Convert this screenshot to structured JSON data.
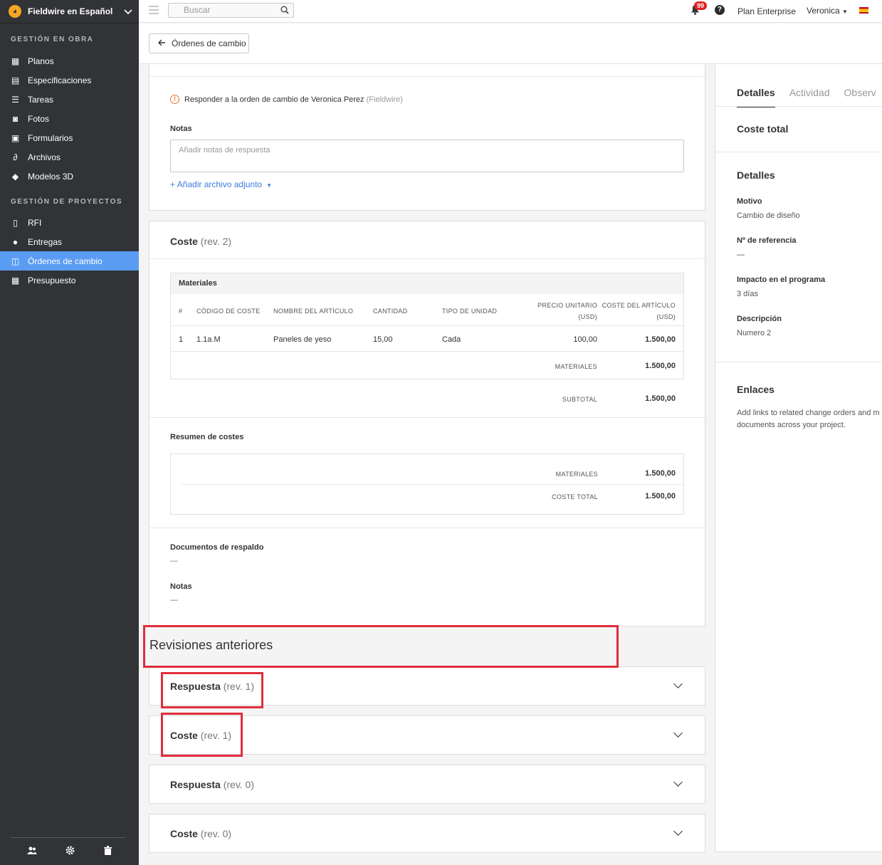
{
  "sidebar": {
    "project_name": "Fieldwire en Español",
    "sections": [
      {
        "title": "GESTIÓN EN OBRA",
        "items": [
          {
            "label": "Planos",
            "icon": "plans-icon"
          },
          {
            "label": "Especificaciones",
            "icon": "specs-icon"
          },
          {
            "label": "Tareas",
            "icon": "list-icon"
          },
          {
            "label": "Fotos",
            "icon": "camera-icon"
          },
          {
            "label": "Formularios",
            "icon": "clipboard-icon"
          },
          {
            "label": "Archivos",
            "icon": "paperclip-icon"
          },
          {
            "label": "Modelos 3D",
            "icon": "cube-icon"
          }
        ]
      },
      {
        "title": "GESTIÓN DE PROYECTOS",
        "items": [
          {
            "label": "RFI",
            "icon": "file-info-icon"
          },
          {
            "label": "Entregas",
            "icon": "person-icon"
          },
          {
            "label": "Órdenes de cambio",
            "icon": "change-order-icon",
            "active": true
          },
          {
            "label": "Presupuesto",
            "icon": "calculator-icon"
          }
        ]
      }
    ],
    "footer_icons": [
      "users-icon",
      "gear-icon",
      "trash-icon"
    ]
  },
  "topbar": {
    "search_placeholder": "Buscar",
    "notification_count": "99",
    "help": "?",
    "plan": "Plan Enterprise",
    "user": "Veronica"
  },
  "header": {
    "back_label": "Órdenes de cambio"
  },
  "response": {
    "notice": "Responder a la orden de cambio de Veronica Perez",
    "notice_source": "(Fieldwire)",
    "notes_label": "Notas",
    "notes_placeholder": "Añadir notas de respuesta",
    "attach_label": "+ Añadir archivo adjunto"
  },
  "cost": {
    "title": "Coste",
    "rev": "(rev. 2)",
    "materials_title": "Materiales",
    "columns": {
      "num": "#",
      "code": "CÓDIGO DE COSTE",
      "name": "NOMBRE DEL ARTÍCULO",
      "qty": "CANTIDAD",
      "unit": "TIPO DE UNIDAD",
      "price_1": "PRECIO UNITARIO",
      "price_2": "(USD)",
      "cost_1": "COSTE DEL ARTÍCULO",
      "cost_2": "(USD)"
    },
    "rows": [
      {
        "num": "1",
        "code": "1.1a.M",
        "name": "Paneles de yeso",
        "qty": "15,00",
        "unit": "Cada",
        "price": "100,00",
        "cost": "1.500,00"
      }
    ],
    "materials_total_label": "MATERIALES",
    "materials_total": "1.500,00",
    "subtotal_label": "SUBTOTAL",
    "subtotal": "1.500,00",
    "summary_title": "Resumen de costes",
    "summary": [
      {
        "label": "MATERIALES",
        "value": "1.500,00"
      },
      {
        "label": "COSTE TOTAL",
        "value": "1.500,00"
      }
    ],
    "docs_label": "Documentos de respaldo",
    "docs_value": "—",
    "notes_label": "Notas",
    "notes_value": "—"
  },
  "previous": {
    "title": "Revisiones anteriores",
    "items": [
      {
        "title": "Respuesta",
        "rev": "(rev. 1)"
      },
      {
        "title": "Coste",
        "rev": "(rev. 1)"
      },
      {
        "title": "Respuesta",
        "rev": "(rev. 0)"
      },
      {
        "title": "Coste",
        "rev": "(rev. 0)"
      }
    ]
  },
  "right_panel": {
    "tabs": [
      "Detalles",
      "Actividad",
      "Observ"
    ],
    "total_cost_label": "Coste total",
    "details_title": "Detalles",
    "fields": [
      {
        "label": "Motivo",
        "value": "Cambio de diseño"
      },
      {
        "label": "Nº de referencia",
        "value": "—"
      },
      {
        "label": "Impacto en el programa",
        "value": "3 días"
      },
      {
        "label": "Descripción",
        "value": "Numero 2"
      }
    ],
    "links_title": "Enlaces",
    "links_text_1": "Add links to related change orders and m",
    "links_text_2": "documents across your project."
  },
  "colors": {
    "sidebar_bg": "#313336",
    "active_item": "#5b9cf3",
    "link": "#3b7ddd",
    "highlight": "#e02d3c",
    "badge": "#e02020"
  }
}
